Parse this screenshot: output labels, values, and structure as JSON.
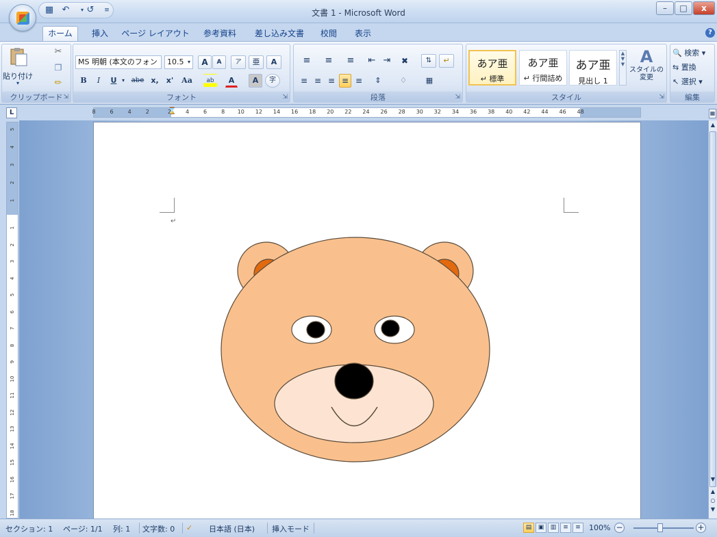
{
  "window": {
    "title": "文書 1 - Microsoft Word",
    "minimize": "–",
    "maximize": "□",
    "close": "x"
  },
  "quick_access": {
    "save_icon": "save-icon",
    "undo_icon": "undo-icon",
    "redo_icon": "redo-icon",
    "customize_icon": "customize-arrow-icon"
  },
  "tabs": [
    "ホーム",
    "挿入",
    "ページ レイアウト",
    "参考資料",
    "差し込み文書",
    "校閲",
    "表示"
  ],
  "help_icon": "?",
  "ribbon": {
    "clipboard": {
      "label": "クリップボード",
      "paste": "貼り付け"
    },
    "font": {
      "label": "フォント",
      "font_name": "MS 明朝 (本文のフォン",
      "font_size": "10.5",
      "bold": "B",
      "italic": "I",
      "underline": "U",
      "strikethrough": "abe",
      "subscript": "x,",
      "superscript": "x'",
      "change_case": "Aa",
      "highlight": "ab",
      "font_color": "A",
      "char_shading": "A",
      "enclose": "字",
      "grow": "A",
      "shrink": "A",
      "clear_format": "ア",
      "phonetic": "亜",
      "char_border": "A"
    },
    "paragraph": {
      "label": "段落"
    },
    "styles": {
      "label": "スタイル",
      "items": [
        {
          "sample": "あア亜",
          "name": "↵ 標準"
        },
        {
          "sample": "あア亜",
          "name": "↵ 行間詰め"
        },
        {
          "sample": "あア亜",
          "name": "見出し 1"
        }
      ],
      "change_styles": "スタイルの 変更"
    },
    "editing": {
      "label": "編集",
      "find": "検索",
      "replace": "置換",
      "select": "選択"
    }
  },
  "ruler": {
    "corner": "L",
    "h_ticks": [
      "8",
      "6",
      "4",
      "2",
      "2",
      "4",
      "6",
      "8",
      "10",
      "12",
      "14",
      "16",
      "18",
      "20",
      "22",
      "24",
      "26",
      "28",
      "30",
      "32",
      "34",
      "36",
      "38",
      "40",
      "42",
      "44",
      "46",
      "48"
    ],
    "v_ticks_top": [
      "5",
      "4",
      "3",
      "2",
      "1"
    ],
    "v_ticks": [
      "1",
      "2",
      "3",
      "4",
      "5",
      "6",
      "7",
      "8",
      "9",
      "10",
      "11",
      "12",
      "13",
      "14",
      "15",
      "16",
      "17",
      "18"
    ]
  },
  "document": {
    "paragraph_mark": "↵"
  },
  "bear_colors": {
    "face": "#f9c08d",
    "ear_inner": "#e2690e",
    "muzzle": "#fde4d2",
    "outline": "#5a4a3a",
    "nose": "#000000"
  },
  "status": {
    "section": "セクション: 1",
    "page": "ページ: 1/1",
    "column": "列: 1",
    "word_count": "文字数: 0",
    "language": "日本語 (日本)",
    "mode": "挿入モード",
    "zoom": "100%",
    "zoom_minus": "−",
    "zoom_plus": "+"
  }
}
